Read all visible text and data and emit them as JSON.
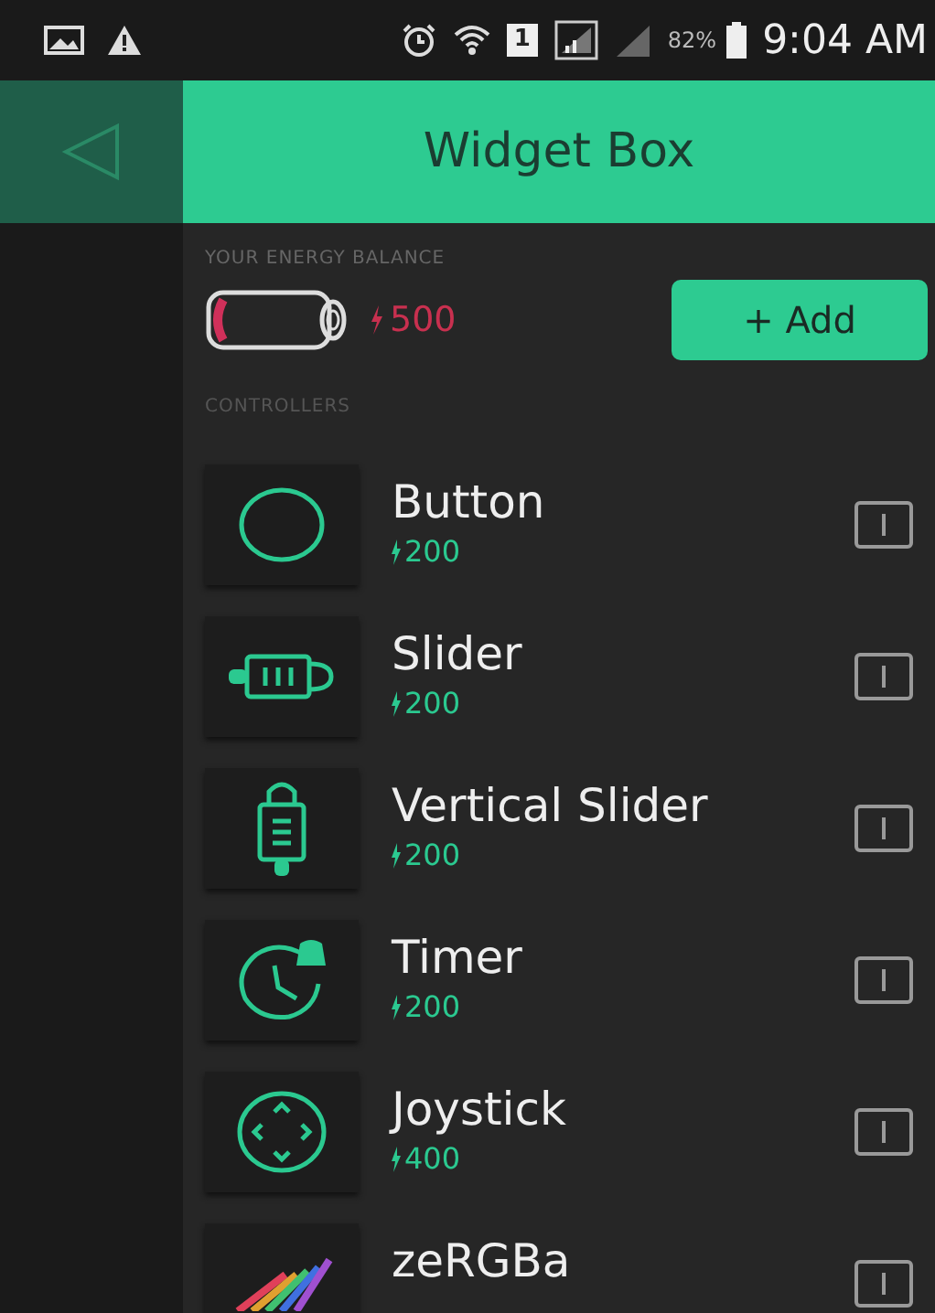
{
  "status_bar": {
    "battery_percent": "82%",
    "time": "9:04 AM",
    "sim": "1"
  },
  "header": {
    "title": "Widget Box"
  },
  "energy": {
    "label": "YOUR ENERGY BALANCE",
    "value": "500",
    "add_button": "+ Add"
  },
  "section": {
    "title": "CONTROLLERS"
  },
  "widgets": [
    {
      "kind": "button",
      "name": "Button",
      "price": "200"
    },
    {
      "kind": "slider",
      "name": "Slider",
      "price": "200"
    },
    {
      "kind": "vslider",
      "name": "Vertical Slider",
      "price": "200"
    },
    {
      "kind": "timer",
      "name": "Timer",
      "price": "200"
    },
    {
      "kind": "joystick",
      "name": "Joystick",
      "price": "400"
    },
    {
      "kind": "rgb",
      "name": "zeRGBa"
    }
  ]
}
